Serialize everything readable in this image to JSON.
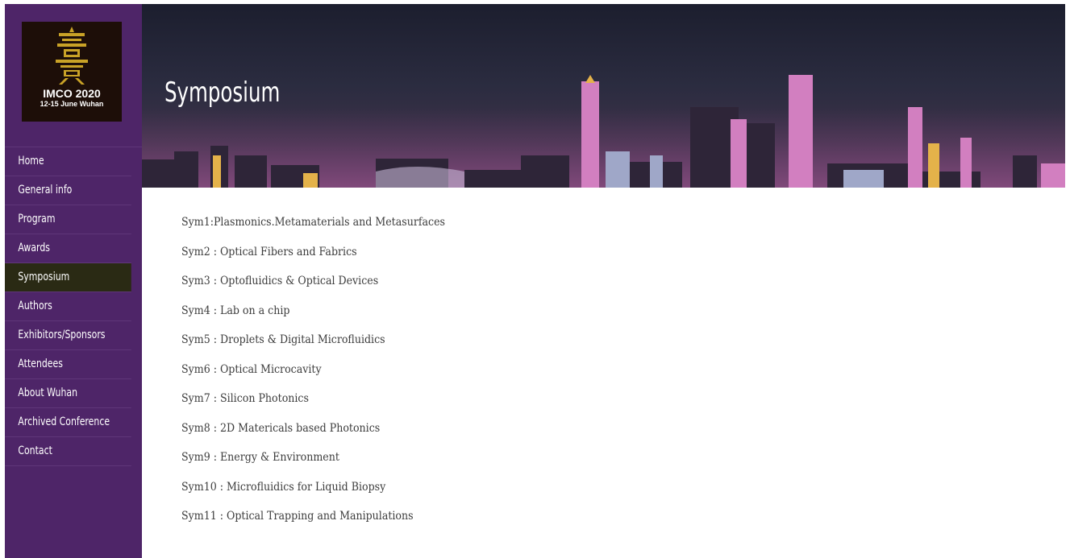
{
  "logo": {
    "title": "IMCO 2020",
    "subtitle": "12-15 June  Wuhan"
  },
  "nav": {
    "items": [
      {
        "label": "Home"
      },
      {
        "label": "General info"
      },
      {
        "label": "Program"
      },
      {
        "label": "Awards"
      },
      {
        "label": "Symposium",
        "active": true
      },
      {
        "label": "Authors"
      },
      {
        "label": "Exhibitors/Sponsors"
      },
      {
        "label": "Attendees"
      },
      {
        "label": "About Wuhan"
      },
      {
        "label": "Archived Conference"
      },
      {
        "label": "Contact"
      }
    ]
  },
  "banner": {
    "title": "Symposium"
  },
  "symposia": [
    "Sym1:Plasmonics.Metamaterials and Metasurfaces",
    "Sym2 : Optical Fibers and Fabrics",
    "Sym3 : Optofluidics & Optical Devices",
    "Sym4 : Lab on a chip",
    "Sym5 : Droplets & Digital Microfluidics",
    "Sym6 : Optical Microcavity",
    "Sym7 : Silicon Photonics",
    "Sym8 : 2D Matericals based Photonics",
    "Sym9 : Energy & Environment",
    "Sym10 : Microfluidics for Liquid Biopsy",
    "Sym11 : Optical Trapping and Manipulations"
  ],
  "colors": {
    "sidebar": "#4e2568",
    "active_nav": "#2a2a14",
    "logo_bg": "#1d0e08",
    "logo_emblem": "#c9a227",
    "text": "#3c3c3c"
  }
}
